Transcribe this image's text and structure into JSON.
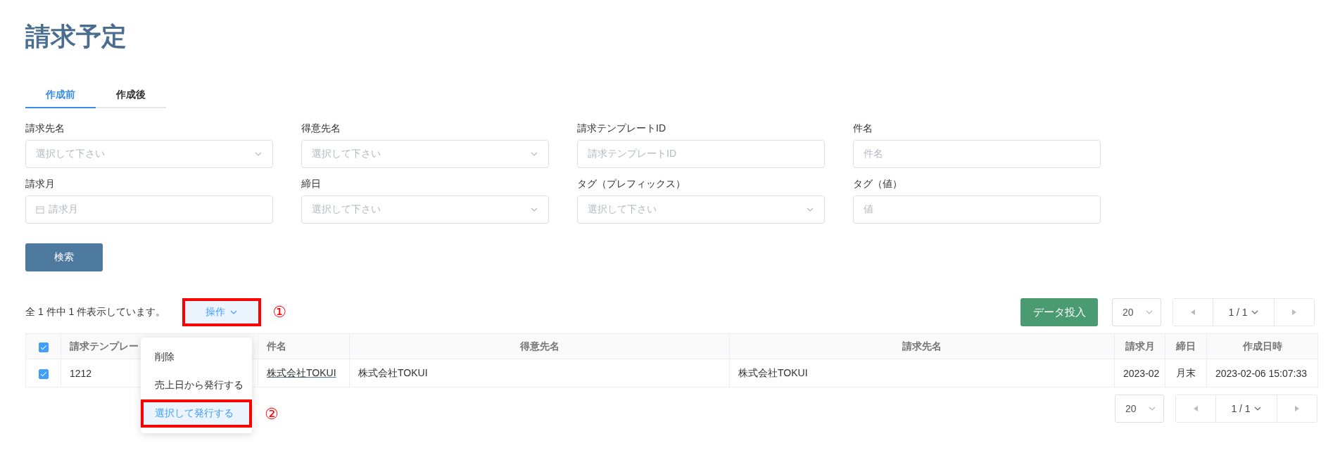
{
  "title": "請求予定",
  "tabs": [
    {
      "label": "作成前",
      "selected": true
    },
    {
      "label": "作成後",
      "selected": false
    }
  ],
  "filters": [
    {
      "label": "請求先名",
      "kind": "select",
      "placeholder": "選択して下さい"
    },
    {
      "label": "得意先名",
      "kind": "select",
      "placeholder": "選択して下さい"
    },
    {
      "label": "請求テンプレートID",
      "kind": "text",
      "placeholder": "請求テンプレートID"
    },
    {
      "label": "件名",
      "kind": "text",
      "placeholder": "件名"
    },
    {
      "label": "請求月",
      "kind": "date",
      "placeholder": "請求月"
    },
    {
      "label": "締日",
      "kind": "select",
      "placeholder": "選択して下さい"
    },
    {
      "label": "タグ（プレフィックス）",
      "kind": "select",
      "placeholder": "選択して下さい"
    },
    {
      "label": "タグ（値）",
      "kind": "text",
      "placeholder": "値"
    }
  ],
  "search_button": "検索",
  "result_summary": "全 1 件中 1 件表示しています。",
  "actions_button": {
    "label": "操作",
    "marked": true,
    "marker": "①"
  },
  "actions_menu": [
    {
      "label": "削除",
      "selected": false,
      "marked": false
    },
    {
      "label": "売上日から発行する",
      "selected": false,
      "marked": false
    },
    {
      "label": "選択して発行する",
      "selected": true,
      "marked": true,
      "marker": "②"
    }
  ],
  "import_button": "データ投入",
  "pager_top": {
    "page_size": "20",
    "page": "1 / 1"
  },
  "table": {
    "all_checked": true,
    "columns": [
      "請求テンプレー",
      "件名",
      "得意先名",
      "請求先名",
      "請求月",
      "締日",
      "作成日時"
    ],
    "rows": [
      {
        "checked": true,
        "cells": [
          {
            "text": "1212",
            "kind": "text"
          },
          {
            "text": "株式会社TOKUI",
            "kind": "link"
          },
          {
            "text": "株式会社TOKUI",
            "kind": "text"
          },
          {
            "text": "株式会社TOKUI",
            "kind": "text"
          },
          {
            "text": "2023-02",
            "kind": "text"
          },
          {
            "text": "月末",
            "kind": "text"
          },
          {
            "text": "2023-02-06 15:07:33",
            "kind": "text"
          }
        ]
      }
    ]
  },
  "pager_bottom": {
    "page_size": "20",
    "page": "1 / 1"
  }
}
